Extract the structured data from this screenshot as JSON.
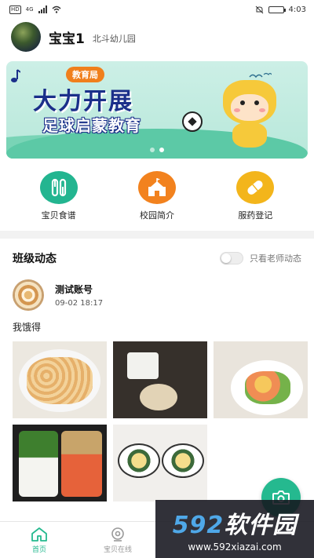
{
  "status_bar": {
    "network_badge": "HD",
    "network_type": "4G",
    "time": "4:03",
    "battery_level": 0.6
  },
  "header": {
    "user_name": "宝宝1",
    "school_name": "北斗幼儿园"
  },
  "banner": {
    "tag": "教育局",
    "title": "大力开展",
    "subtitle": "足球启蒙教育",
    "slide_count": 2,
    "active_slide": 1
  },
  "quick_actions": [
    {
      "label": "宝贝食谱",
      "color": "#23b590",
      "icon": "cutlery-icon"
    },
    {
      "label": "校园简介",
      "color": "#f2821e",
      "icon": "school-icon"
    },
    {
      "label": "服药登记",
      "color": "#f3b51b",
      "icon": "pill-icon"
    }
  ],
  "feed": {
    "title": "班级动态",
    "filter_label": "只看老师动态",
    "filter_on": false
  },
  "post": {
    "author": "测试账号",
    "time": "09-02 18:17",
    "text": "我饿得",
    "photo_count": 5
  },
  "bottom_nav": {
    "items": [
      {
        "label": "首页",
        "icon": "home-icon",
        "active": true
      },
      {
        "label": "宝贝在线",
        "icon": "camera-live-icon",
        "active": false
      }
    ],
    "accent": "#25b98f"
  },
  "watermark": {
    "logo_num": "592",
    "logo_cn": "软件园",
    "url": "www.592xiazai.com"
  }
}
